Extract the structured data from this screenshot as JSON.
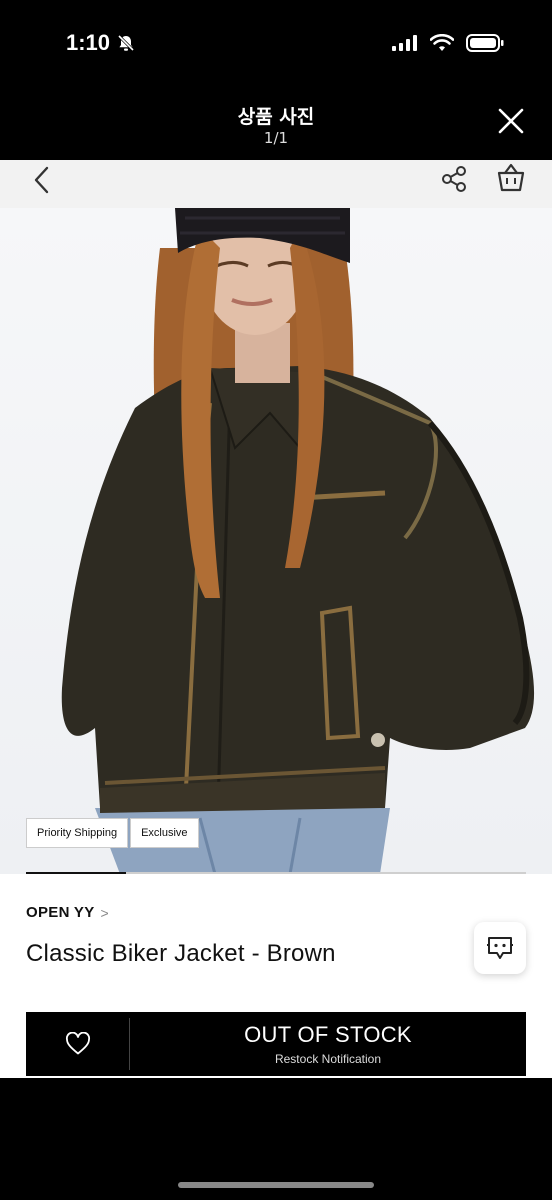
{
  "status_bar": {
    "time": "1:10",
    "icons": [
      "bell-slash-icon",
      "signal-icon",
      "wifi-icon",
      "battery-icon"
    ]
  },
  "viewer": {
    "title": "상품 사진",
    "counter": "1/1",
    "close_icon": "close-icon"
  },
  "app_nav": {
    "icons": [
      "back-icon",
      "share-icon",
      "shopping-bag-icon"
    ]
  },
  "product": {
    "badges": [
      "Priority Shipping",
      "Exclusive"
    ],
    "image_progress": 0.2,
    "brand": "OPEN YY",
    "brand_chevron": ">",
    "title": "Classic Biker Jacket - Brown"
  },
  "buy_bar": {
    "wishlist_icon": "heart-outline-icon",
    "status_label": "OUT OF STOCK",
    "sub_label": "Restock Notification"
  },
  "colors": {
    "background": "#000000",
    "nav": "#f2f2f2",
    "buy_bar": "#000000"
  }
}
